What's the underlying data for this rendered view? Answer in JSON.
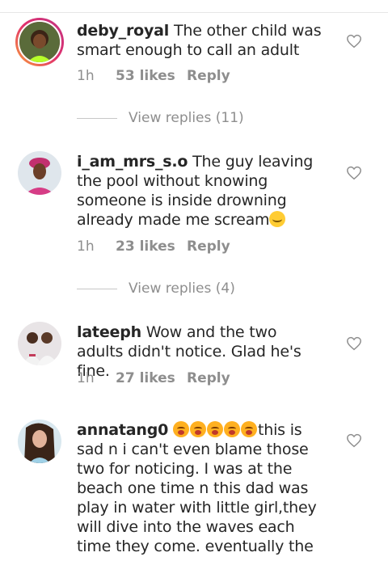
{
  "comments": [
    {
      "username": "deby_royal",
      "text": "The other child was smart enough to call an adult",
      "time": "1h",
      "likes": "53 likes",
      "reply": "Reply",
      "view_replies": "View replies (11)"
    },
    {
      "username": "i_am_mrs_s.o",
      "text": "The guy leaving the pool without knowing someone is inside drowning already made me scream",
      "time": "1h",
      "likes": "23 likes",
      "reply": "Reply",
      "view_replies": "View replies (4)"
    },
    {
      "username": "lateeph",
      "text": "Wow and the two adults didn't notice. Glad he's fine.",
      "time": "1h",
      "likes": "27 likes",
      "reply": "Reply"
    },
    {
      "username": "annatang0",
      "text": "this is sad n i can't even blame those two for noticing. I was at the beach one time n this dad was play in water with little girl,they will dive into the waves each time they come. eventually the"
    }
  ],
  "icons": {
    "like": "heart-outline-icon",
    "emoji_smile": "smiling-face-emoji",
    "emoji_cry": "loudly-crying-face-emoji"
  },
  "colors": {
    "text": "#262626",
    "secondary": "#8e8e8e",
    "story_ring": "#e1306c"
  }
}
